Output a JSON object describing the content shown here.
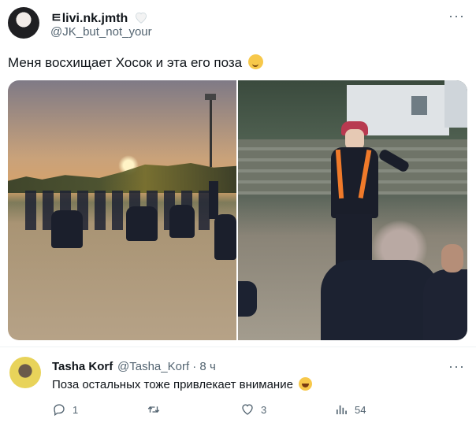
{
  "tweet": {
    "display_name": "ㅌlivi.nk.jmth",
    "handle": "@JK_but_not_your",
    "text": "Меня восхищает Хосок и эта его поза",
    "more_label": "···",
    "verified_icon": "white-heart-icon",
    "text_emoji_icon": "relieved-face-emoji-icon"
  },
  "reply": {
    "display_name": "Tasha Korf",
    "handle_time": "@Tasha_Korf · 8 ч",
    "text": "Поза остальных тоже привлекает внимание",
    "text_emoji_icon": "laughing-tears-emoji-icon",
    "more_label": "···",
    "actions": {
      "reply_count": "1",
      "retweet_count": "",
      "like_count": "3",
      "views_count": "54"
    }
  }
}
